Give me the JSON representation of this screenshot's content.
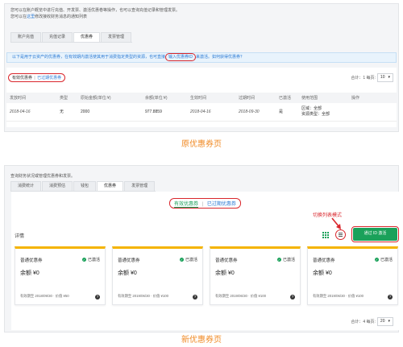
{
  "old_ui": {
    "intro_line1": "您可以在账户概览中进行充值、开发票、激活优惠卷等操作，也可以查询充值记录和管理发票。",
    "intro_line2_pre": "您可以在",
    "intro_line2_link": "这里",
    "intro_line2_post": "修改接收财务消息的通知列表",
    "tabs": [
      "账户充值",
      "充值记录",
      "优惠券",
      "发票管理"
    ],
    "active_tab": "优惠券",
    "notice_pre": "以下是用于云资产的优惠券，在有效期内激活使其用于消费指定类型的资源，也可直接",
    "notice_ring": "输入优惠券ID",
    "notice_post": "来激活。如何获得优惠券？",
    "filter_active": "有效优惠券",
    "filter_sep": "|",
    "filter_expired": "已过期优惠券",
    "total_label": "合计：1 每页:",
    "page_size": "10",
    "columns": [
      "发放时间",
      "类型",
      "原始金额(单位:¥)",
      "余额(单位:¥)",
      "生效时间",
      "过期时间",
      "已激活",
      "使用范围",
      "操作"
    ],
    "row": {
      "issued": "2018-04-16",
      "type": "无",
      "original": "2000",
      "balance": "977.8859",
      "effective": "2018-04-16",
      "expires": "2018-09-30",
      "activated": "是",
      "scope_line1": "区域：全部",
      "scope_line2": "资源类型：全部",
      "action": ""
    },
    "caption": "原优惠券页"
  },
  "new_ui": {
    "intro": "查询财务状况或管理优惠券和发票。",
    "tabs": [
      "消费统计",
      "消费预估",
      "钱包",
      "优惠券",
      "发票管理"
    ],
    "active_tab": "优惠券",
    "filter_active": "有效优惠券",
    "filter_sep": "|",
    "filter_expired": "已过期优惠券",
    "switch_hint": "切换列表模式",
    "detail_label": "详情",
    "bind_button": "通过 ID 激活",
    "cards": [
      {
        "title": "普通优惠券",
        "status": "已激活",
        "balance": "余额 ¥0",
        "expiry": "有效期至 2018/09/30 · 价值 ¥50"
      },
      {
        "title": "普通优惠券",
        "status": "已激活",
        "balance": "余额 ¥0",
        "expiry": "有效期至 2019/06/30 · 价值 ¥100"
      },
      {
        "title": "普通优惠券",
        "status": "已激活",
        "balance": "余额 ¥0",
        "expiry": "有效期至 2019/06/30 · 价值 ¥100"
      },
      {
        "title": "普通优惠券",
        "status": "已激活",
        "balance": "余额 ¥0",
        "expiry": "有效期至 2019/06/30 · 价值 ¥100"
      }
    ],
    "total_label": "合计：4 每页:",
    "page_size": "20",
    "caption": "新优惠券页"
  },
  "colors": {
    "accent_green": "#1aa15a",
    "highlight_red": "#d9262c",
    "caption_orange": "#f08a24",
    "link_blue": "#2a7ad4",
    "card_top_yellow": "#f5b400"
  },
  "icons": [
    "grid-view-icon",
    "list-view-icon",
    "check-circle-icon",
    "question-icon",
    "chevron-down-icon",
    "red-arrow-icon"
  ]
}
